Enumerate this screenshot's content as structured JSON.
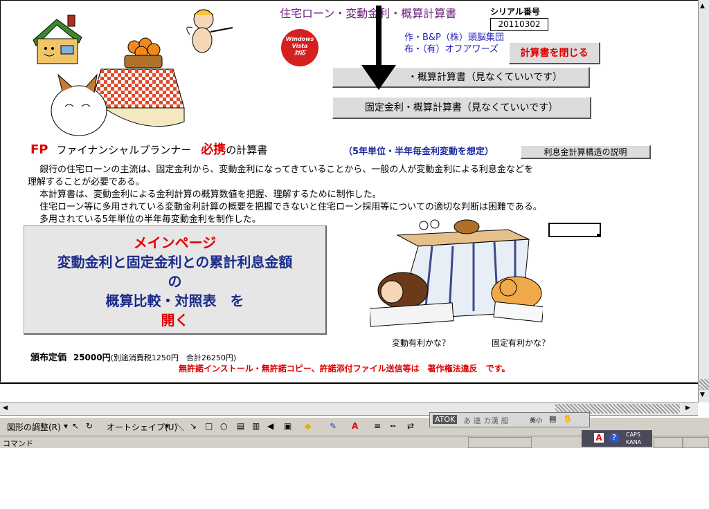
{
  "header": {
    "title": "住宅ローン・変動金利・概算計算書",
    "serial_label": "シリアル番号",
    "serial_value": "20110302",
    "credit_line1": "作・B&P（株）頭脳集団",
    "credit_line2": "布・（有）オフアワーズ",
    "close_button": "計算書を閉じる",
    "variable_button": "・概算計算書（見なくていいです）",
    "fixed_button": "固定金利・概算計算書（見なくていいです）",
    "vista_badge": [
      "Windows",
      "Vista",
      "対応"
    ]
  },
  "intro": {
    "fp": "FP",
    "planner": "ファイナンシャルプランナー",
    "hikkei": "必携",
    "calc": "の計算書",
    "note": "（5年単位・半年毎金利変動を想定）",
    "explain_button": "利息金計算構造の説明",
    "paragraphs": [
      "　銀行の住宅ローンの主流は、固定金利から、変動金利になってきていることから、一般の人が変動金利による利息金などを",
      "理解することが必要である。",
      "　本計算書は、変動金利による金利計算の概算数値を把握、理解するために制作した。",
      "　住宅ローン等に多用されている変動金利計算の概要を把握できないと住宅ローン採用等についての適切な判断は困難である。",
      "　多用されている5年単位の半年毎変動金利を制作した。"
    ]
  },
  "main_button": {
    "line1": "メインページ",
    "line2": "変動金利と固定金利との累計利息金額",
    "line3": "の",
    "line4": "概算比較・対照表　を",
    "line5": "開く"
  },
  "price": {
    "label": "頒布定価",
    "amount": "25000円",
    "note": "(別途消費税1250円　合計26250円)"
  },
  "warning": "無許諾インストール・無許諾コピー、許諾添付ファイル送信等は　著作権法違反　です。",
  "illustration": {
    "q1": "変動有利かな？",
    "q2": "固定有利かな？"
  },
  "toolbar": {
    "adjust": "図形の調整(R)",
    "autoshape": "オートシェイプ(U)"
  },
  "atok": {
    "name": "ATOK",
    "modes": "あ 連 カ漢 般",
    "size": "英小"
  },
  "tray": {
    "caps": "CAPS",
    "kana": "KANA"
  },
  "status": {
    "mode": "コマンド"
  },
  "colors": {
    "accent_red": "#e00000",
    "title_purple": "#6a1b7a",
    "blue": "#1a2a8a"
  }
}
